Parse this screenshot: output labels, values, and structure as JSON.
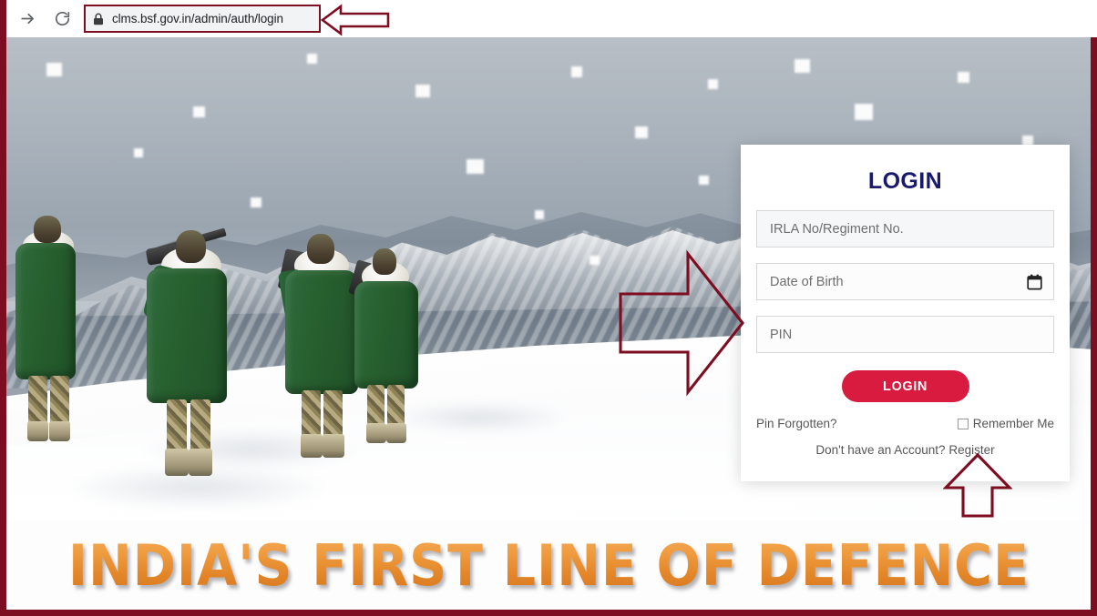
{
  "browser": {
    "forward_icon": "forward-arrow-icon",
    "reload_icon": "reload-icon",
    "lock_icon": "lock-icon",
    "url": "clms.bsf.gov.in/admin/auth/login"
  },
  "annotations": {
    "url_arrow": "left-pointing-arrow",
    "form_arrow": "right-pointing-arrow",
    "register_arrow": "up-pointing-arrow",
    "color": "#7d0d20"
  },
  "hero": {
    "alt": "BSF soldiers patrolling snow-covered mountain terrain",
    "banner_text": "INDIA'S FIRST LINE OF DEFENCE"
  },
  "login": {
    "title": "LOGIN",
    "fields": [
      {
        "name": "irla-regiment",
        "placeholder": "IRLA No/Regiment No.",
        "value": "",
        "type": "text"
      },
      {
        "name": "date-of-birth",
        "placeholder": "Date of Birth",
        "value": "",
        "type": "date",
        "icon": "calendar-icon"
      },
      {
        "name": "pin",
        "placeholder": "PIN",
        "value": "",
        "type": "password"
      }
    ],
    "submit_label": "LOGIN",
    "pin_forgotten_label": "Pin Forgotten?",
    "remember_label": "Remember Me",
    "remember_checked": false,
    "register_label": "Don't have an Account? Register",
    "title_color": "#191970",
    "button_color": "#d81b3f"
  }
}
